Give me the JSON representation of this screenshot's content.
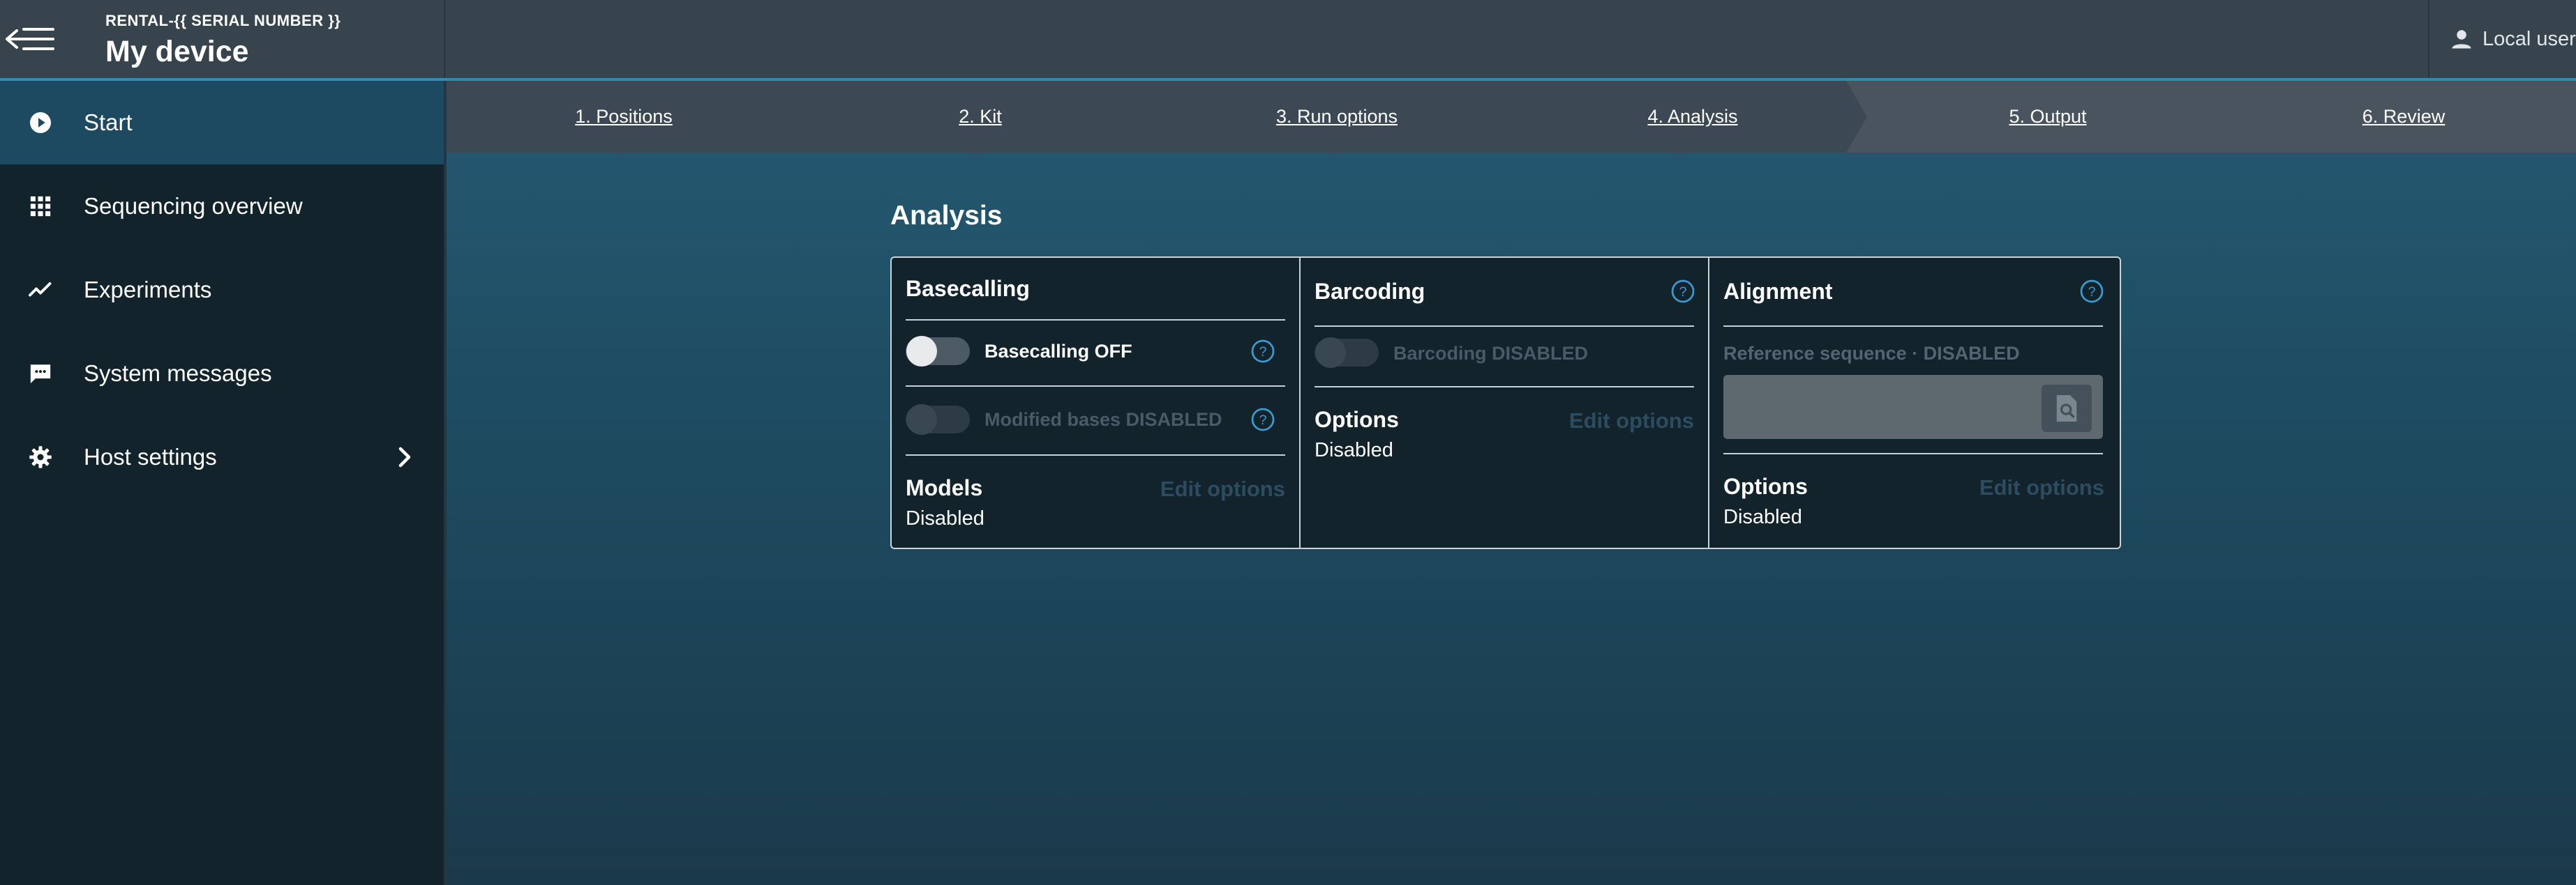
{
  "header": {
    "device_subtitle": "RENTAL-{{ SERIAL NUMBER }}",
    "device_title": "My device",
    "user_label": "Local user"
  },
  "sidebar": {
    "items": [
      {
        "label": "Start",
        "icon": "play-circle-icon",
        "active": true
      },
      {
        "label": "Sequencing overview",
        "icon": "grid-icon"
      },
      {
        "label": "Experiments",
        "icon": "trend-line-icon"
      },
      {
        "label": "System messages",
        "icon": "chat-icon"
      },
      {
        "label": "Host settings",
        "icon": "gear-icon",
        "chevron": "chevron-right-icon"
      }
    ]
  },
  "stepper": {
    "steps": [
      {
        "label": "1. Positions"
      },
      {
        "label": "2. Kit"
      },
      {
        "label": "3. Run options"
      },
      {
        "label": "4. Analysis"
      },
      {
        "label": "5. Output"
      },
      {
        "label": "6. Review"
      }
    ],
    "current_step": 4
  },
  "analysis": {
    "title": "Analysis",
    "basecalling": {
      "title": "Basecalling",
      "toggle_label": "Basecalling OFF",
      "toggle_on": false,
      "modified_label": "Modified bases DISABLED",
      "models_title": "Models",
      "edit_label": "Edit options",
      "models_value": "Disabled"
    },
    "barcoding": {
      "title": "Barcoding",
      "toggle_label": "Barcoding DISABLED",
      "options_title": "Options",
      "edit_label": "Edit options",
      "options_value": "Disabled"
    },
    "alignment": {
      "title": "Alignment",
      "reference_label": "Reference sequence · DISABLED",
      "options_title": "Options",
      "edit_label": "Edit options",
      "options_value": "Disabled"
    }
  },
  "colors": {
    "accent": "#2f8bb5",
    "sidebar_active": "#1d4a61",
    "panel_bg": "#13232c",
    "help_icon": "#3a9bd0"
  }
}
